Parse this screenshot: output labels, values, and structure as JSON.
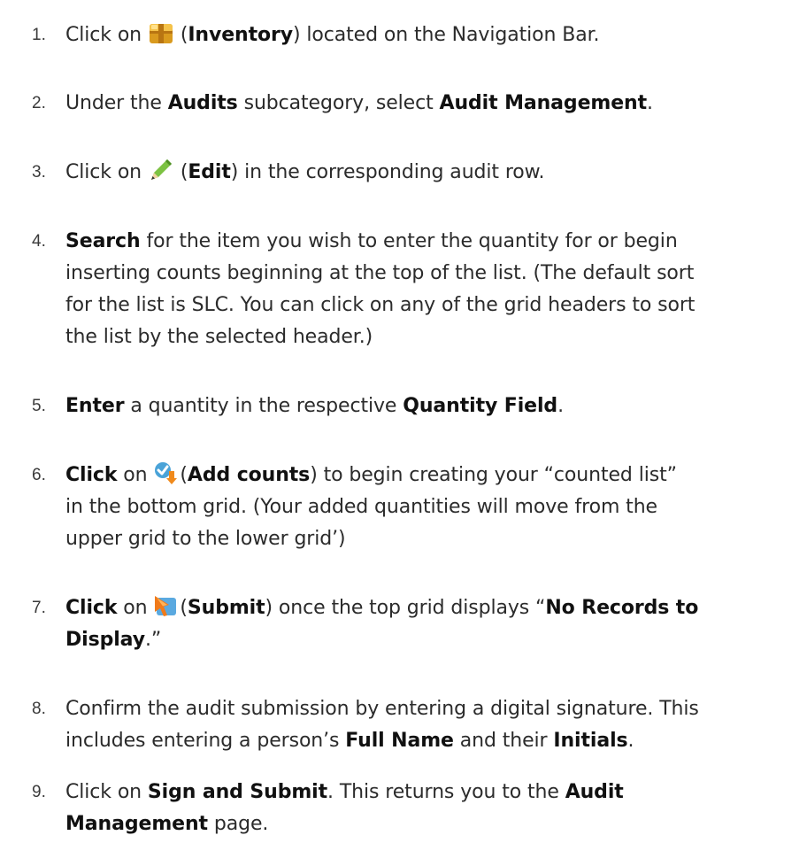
{
  "steps": [
    {
      "number": "1.",
      "pre": "Click on",
      "icon": "inventory-box-icon",
      "paren_open": "(",
      "bold": "Inventory",
      "paren_close": ")",
      "post": " located on the Navigation Bar."
    },
    {
      "number": "2.",
      "a": "Under the ",
      "b": "Audits",
      "c": " subcategory, select ",
      "d": "Audit Management",
      "e": "."
    },
    {
      "number": "3.",
      "pre": "Click on",
      "icon": "edit-pencil-icon",
      "paren_open": "(",
      "bold": "Edit",
      "paren_close": ")",
      "post": " in the corresponding audit row."
    },
    {
      "number": "4.",
      "bold": "Search",
      "line1": " for the item you wish to enter the quantity for or begin",
      "line2": "inserting counts beginning at the top of the list.  (The default sort",
      "line3": "for the list is SLC.  You can click on any of the grid headers to sort",
      "line4": "the list by the selected header.)"
    },
    {
      "number": "5.",
      "a": "Enter",
      "b": " a quantity in the respective ",
      "c": "Quantity Field",
      "d": "."
    },
    {
      "number": "6.",
      "bold": "Click",
      "pre": " on",
      "icon": "add-counts-icon",
      "paren_open": "(",
      "bold2": "Add counts",
      "paren_close": ")",
      "post": " to begin creating your “counted list”",
      "line2": "in the bottom grid.  (Your added quantities will move from  the",
      "line3": "upper grid to the lower grid’)"
    },
    {
      "number": "7.",
      "bold": "Click",
      "pre": " on",
      "icon": "submit-icon",
      "paren_open": "(",
      "bold2": "Submit",
      "paren_close": ")",
      "post": " once the top grid displays “",
      "bold3": "No Records to",
      "bold4": "Display",
      "end": ".”"
    },
    {
      "number": "8.",
      "line1": "Confirm the audit submission by entering a digital signature.  This",
      "a": "includes entering a person’s ",
      "b": "Full Name",
      "c": " and their ",
      "d": "Initials",
      "e": "."
    },
    {
      "number": "9.",
      "a": "Click on ",
      "b": "Sign and Submit",
      "c": ".  This returns you to the ",
      "d": "Audit",
      "e": "Management",
      "f": " page."
    }
  ]
}
